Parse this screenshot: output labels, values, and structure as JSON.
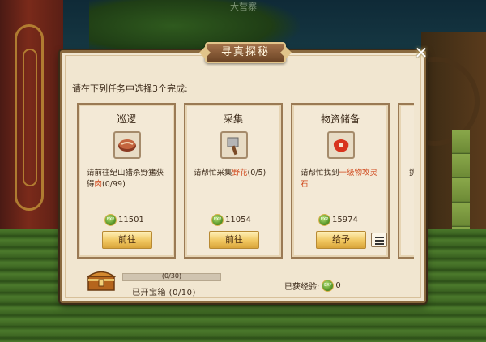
{
  "scene": {
    "sign_text": "大营寨"
  },
  "dialog": {
    "title": "寻真探秘",
    "close_icon": "✕",
    "instruction": "请在下列任务中选择3个完成:",
    "exp_coin_text": "EXP",
    "cards": [
      {
        "title": "巡逻",
        "icon": "meat-icon",
        "desc_before": "请前往纪山猎杀野猪获得",
        "desc_highlight": "肉",
        "desc_after": "(0/99)",
        "exp": "11501",
        "action": "前往"
      },
      {
        "title": "采集",
        "icon": "cleaver-icon",
        "desc_before": "请帮忙采集",
        "desc_highlight": "野花",
        "desc_after": "(0/5)",
        "exp": "11054",
        "action": "前往"
      },
      {
        "title": "物资储备",
        "icon": "raw-meat-icon",
        "desc_before": "请帮忙找到",
        "desc_highlight": "一级物攻灵石",
        "desc_after": "",
        "exp": "15974",
        "action": "给予"
      },
      {
        "title": "",
        "desc_before": "挑",
        "desc_highlight": "",
        "desc_after": ""
      }
    ],
    "chest": {
      "progress_text": "(0/30)",
      "progress_value": 0,
      "label": "已开宝箱 (0/10)"
    },
    "exp_total": {
      "label": "已获经验:",
      "value": "0"
    }
  }
}
